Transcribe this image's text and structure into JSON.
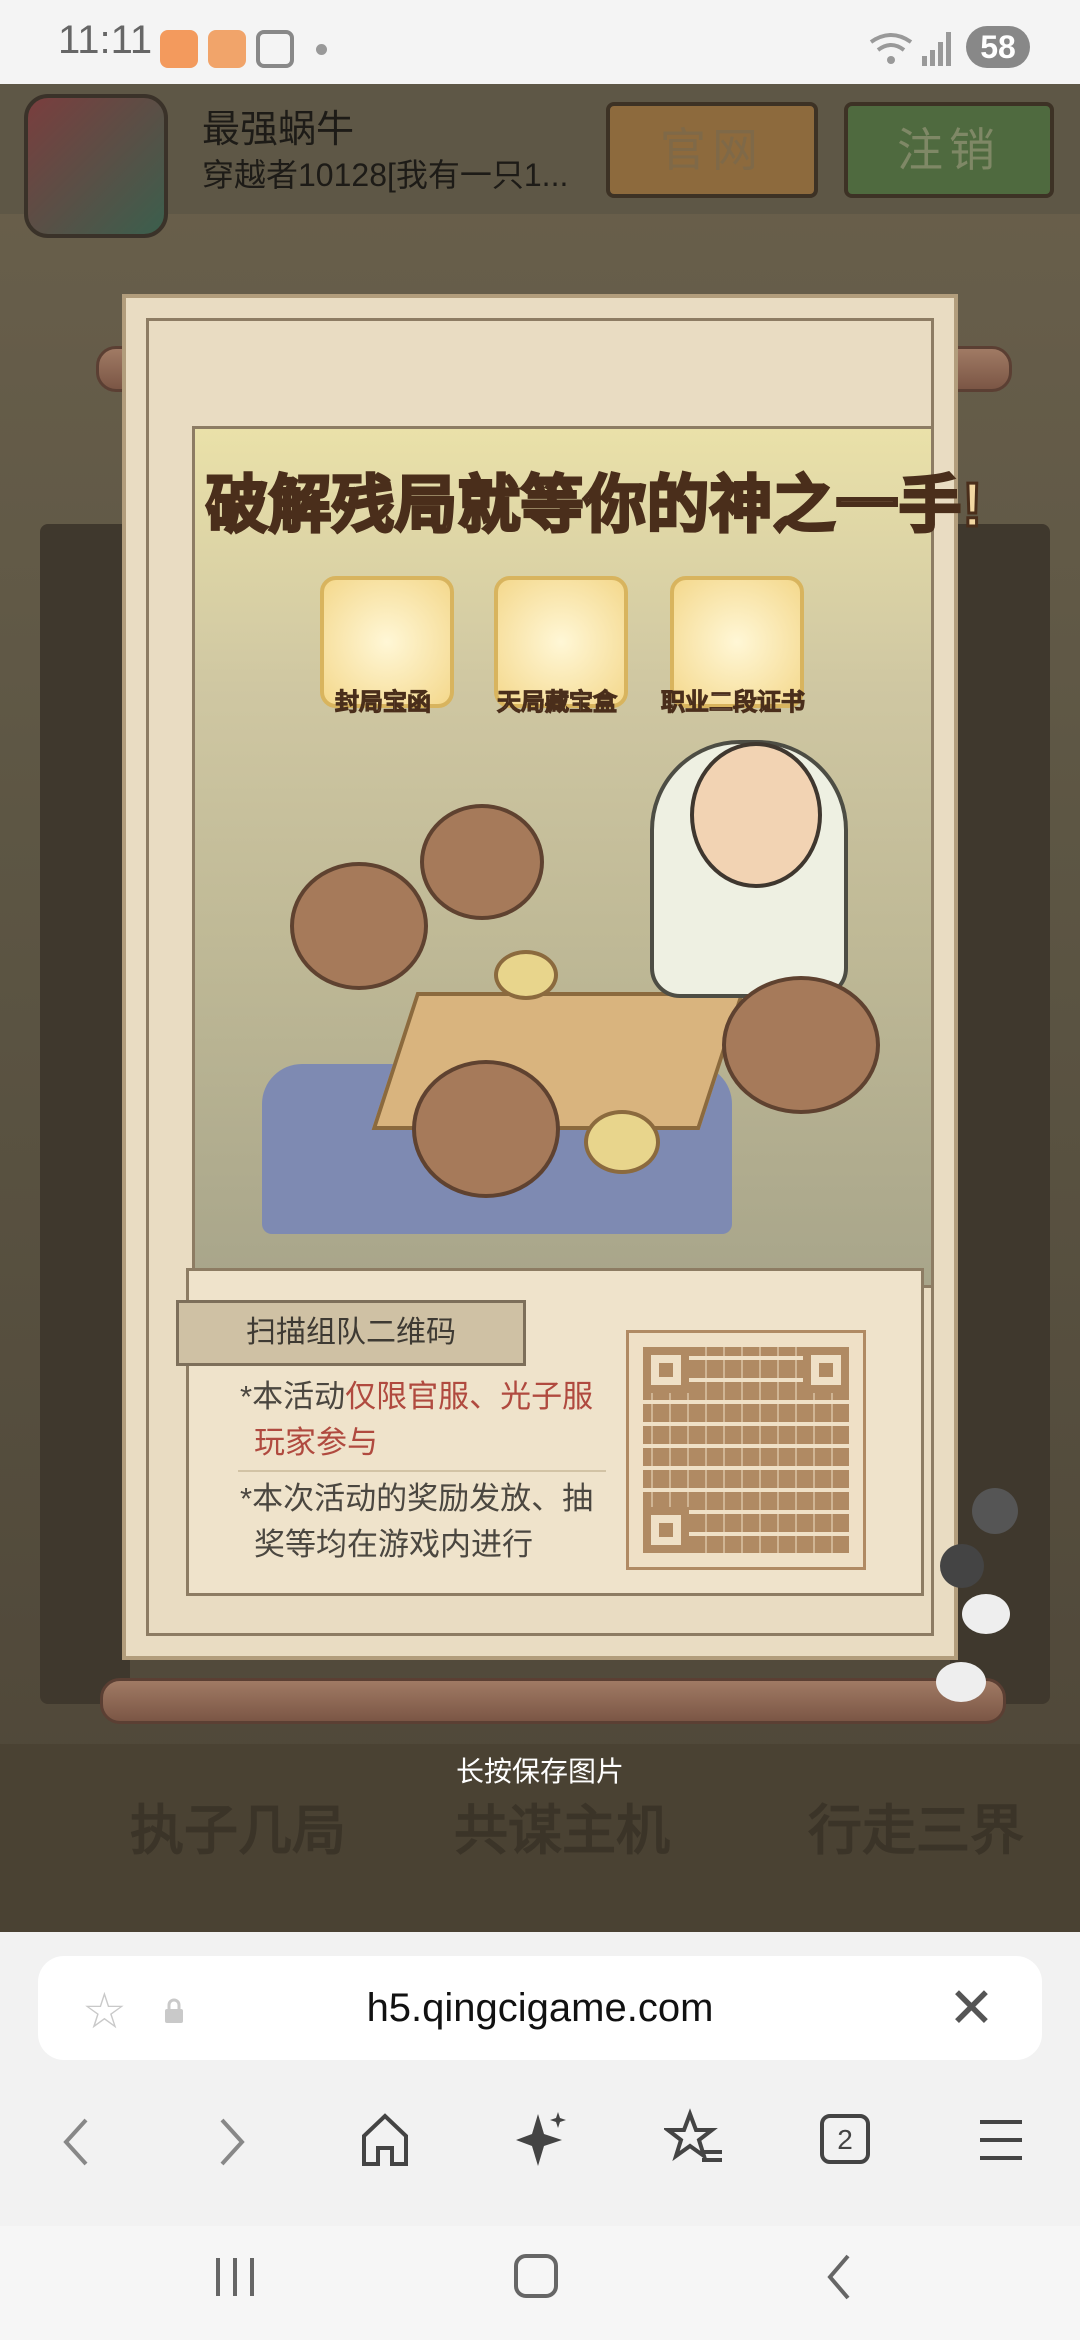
{
  "status_bar": {
    "time": "11:11",
    "battery": "58"
  },
  "game": {
    "title": "最强蜗牛",
    "subtitle": "穿越者10128[我有一只1...",
    "btn_official": "官网",
    "btn_logout": "注销",
    "bg_left": "执子几局",
    "bg_center": "共谋主机",
    "bg_right": "行走三界"
  },
  "poster": {
    "headline": "破解残局就等你的神之一手!",
    "rewards": [
      {
        "label": "封局宝函"
      },
      {
        "label": "天局藏宝盒"
      },
      {
        "label": "职业二段证书"
      }
    ],
    "qr_tag": "扫描组队二维码",
    "note1_prefix": "*本活动",
    "note1_highlight": "仅限官服、光子服",
    "note1_highlight2": "玩家参与",
    "note2_line1": "*本次活动的奖励发放、抽",
    "note2_line2": "奖等均在游戏内进行",
    "save_hint": "长按保存图片"
  },
  "browser": {
    "url": "h5.qingcigame.com",
    "tab_count": "2"
  }
}
